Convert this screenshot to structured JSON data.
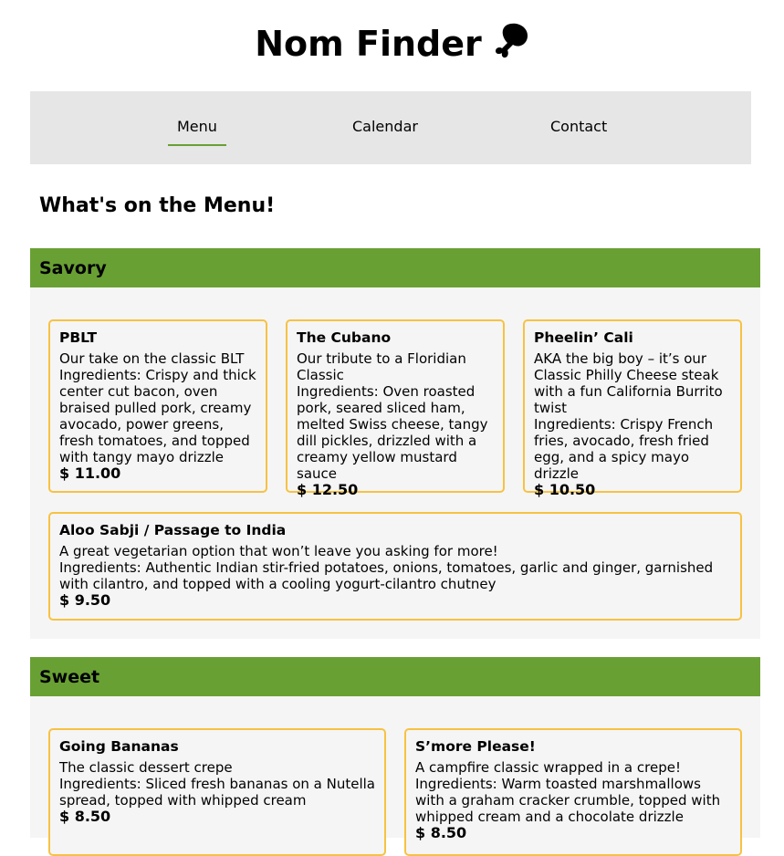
{
  "header": {
    "title": "Nom Finder",
    "logo_icon": "drumstick-icon"
  },
  "nav": {
    "items": [
      {
        "label": "Menu",
        "active": true
      },
      {
        "label": "Calendar",
        "active": false
      },
      {
        "label": "Contact",
        "active": false
      }
    ]
  },
  "main": {
    "heading": "What's on the Menu!"
  },
  "sections": [
    {
      "title": "Savory",
      "items": [
        {
          "name": "PBLT",
          "description": "Our take on the classic BLT",
          "ingredients": "Ingredients: Crispy and thick center cut bacon, oven braised pulled pork, creamy avocado, power greens, fresh tomatoes, and topped with tangy mayo drizzle",
          "price": "$ 11.00"
        },
        {
          "name": "The Cubano",
          "description": "Our tribute to a Floridian Classic",
          "ingredients": "Ingredients: Oven roasted pork, seared sliced ham, melted Swiss cheese, tangy dill pickles, drizzled with a creamy yellow mustard sauce",
          "price": "$ 12.50"
        },
        {
          "name": "Pheelin’ Cali",
          "description": "AKA the big boy – it’s our Classic Philly Cheese steak with a fun California Burrito twist",
          "ingredients": "Ingredients: Crispy French fries, avocado, fresh fried egg, and a spicy mayo drizzle",
          "price": "$ 10.50"
        },
        {
          "name": "Aloo Sabji / Passage to India",
          "description": "A great vegetarian option that won’t leave you asking for more!",
          "ingredients": "Ingredients: Authentic Indian stir-fried potatoes, onions, tomatoes, garlic and ginger, garnished with cilantro, and topped with a cooling yogurt-cilantro chutney",
          "price": "$ 9.50"
        }
      ]
    },
    {
      "title": "Sweet",
      "items": [
        {
          "name": "Going Bananas",
          "description": "The classic dessert crepe",
          "ingredients": "Ingredients: Sliced fresh bananas on a Nutella spread, topped with whipped cream",
          "price": "$ 8.50"
        },
        {
          "name": "S’more Please!",
          "description": "A campfire classic wrapped in a crepe!",
          "ingredients": "Ingredients: Warm toasted marshmallows with a graham cracker crumble, topped with whipped cream and a chocolate drizzle",
          "price": "$ 8.50"
        }
      ]
    }
  ],
  "colors": {
    "accent_green": "#69a034",
    "card_border": "#f7c242",
    "nav_bg": "#e6e6e6",
    "section_bg": "#f5f5f5"
  }
}
